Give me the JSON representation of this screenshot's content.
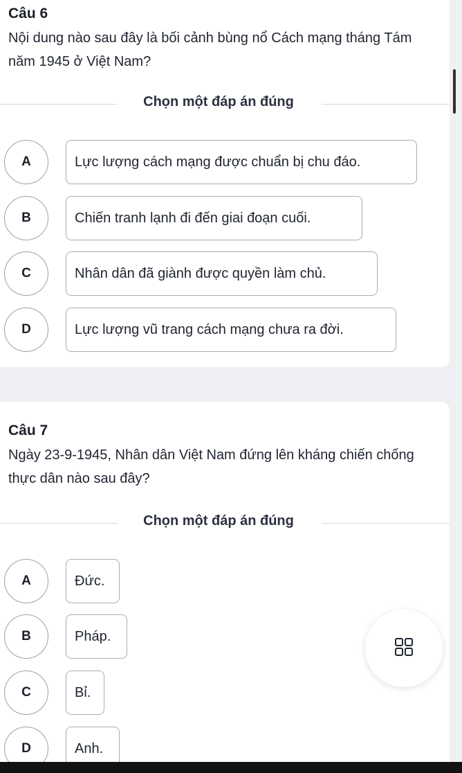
{
  "questions": [
    {
      "title": "Câu 6",
      "text": "Nội dung nào sau đây là bối cảnh bùng nổ Cách mạng tháng Tám năm 1945 ở Việt Nam?",
      "instruction": "Chọn một đáp án đúng",
      "options": [
        {
          "letter": "A",
          "text": "Lực lượng cách mạng được chuẩn bị chu đáo."
        },
        {
          "letter": "B",
          "text": "Chiến tranh lạnh đi đến giai đoạn cuối."
        },
        {
          "letter": "C",
          "text": "Nhân dân đã giành được quyền làm chủ."
        },
        {
          "letter": "D",
          "text": "Lực lượng vũ trang cách mạng chưa ra đời."
        }
      ]
    },
    {
      "title": "Câu 7",
      "text": "Ngày 23-9-1945, Nhân dân Việt Nam đứng lên kháng chiến chống thực dân nào sau đây?",
      "instruction": "Chọn một đáp án đúng",
      "options": [
        {
          "letter": "A",
          "text": "Đức."
        },
        {
          "letter": "B",
          "text": "Pháp."
        },
        {
          "letter": "C",
          "text": "Bỉ."
        },
        {
          "letter": "D",
          "text": "Anh."
        }
      ]
    }
  ],
  "fab_icon": "grid-icon",
  "colors": {
    "background": "#eef0f3",
    "card": "#ffffff",
    "border": "#a7adb6",
    "text": "#1f2430"
  }
}
